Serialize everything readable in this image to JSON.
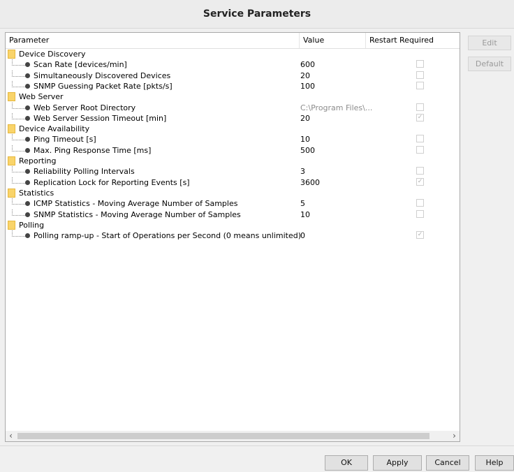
{
  "window": {
    "title": "Service Parameters"
  },
  "table": {
    "headers": {
      "parameter": "Parameter",
      "value": "Value",
      "restart": "Restart Required"
    },
    "groups": [
      {
        "label": "Device Discovery",
        "items": [
          {
            "label": "Scan Rate [devices/min]",
            "value": "600",
            "restart": false
          },
          {
            "label": "Simultaneously Discovered Devices",
            "value": "20",
            "restart": false
          },
          {
            "label": "SNMP Guessing Packet Rate [pkts/s]",
            "value": "100",
            "restart": false
          }
        ]
      },
      {
        "label": "Web Server",
        "items": [
          {
            "label": "Web Server Root Directory",
            "value": "C:\\Program Files\\...",
            "restart": false,
            "dimmed": true
          },
          {
            "label": "Web Server Session Timeout [min]",
            "value": "20",
            "restart": true
          }
        ]
      },
      {
        "label": "Device Availability",
        "items": [
          {
            "label": "Ping Timeout [s]",
            "value": "10",
            "restart": false
          },
          {
            "label": "Max. Ping Response Time [ms]",
            "value": "500",
            "restart": false
          }
        ]
      },
      {
        "label": "Reporting",
        "items": [
          {
            "label": "Reliability Polling Intervals",
            "value": "3",
            "restart": false
          },
          {
            "label": "Replication Lock for Reporting Events [s]",
            "value": "3600",
            "restart": true
          }
        ]
      },
      {
        "label": "Statistics",
        "items": [
          {
            "label": "ICMP Statistics - Moving Average Number of Samples",
            "value": "5",
            "restart": false
          },
          {
            "label": "SNMP Statistics - Moving Average Number of Samples",
            "value": "10",
            "restart": false
          }
        ]
      },
      {
        "label": "Polling",
        "items": [
          {
            "label": "Polling ramp-up - Start of Operations per Second (0 means unlimited)",
            "value": "0",
            "restart": true
          }
        ]
      }
    ]
  },
  "side_buttons": {
    "edit": "Edit",
    "default": "Default"
  },
  "footer_buttons": {
    "ok": "OK",
    "apply": "Apply",
    "cancel": "Cancel",
    "help": "Help"
  }
}
